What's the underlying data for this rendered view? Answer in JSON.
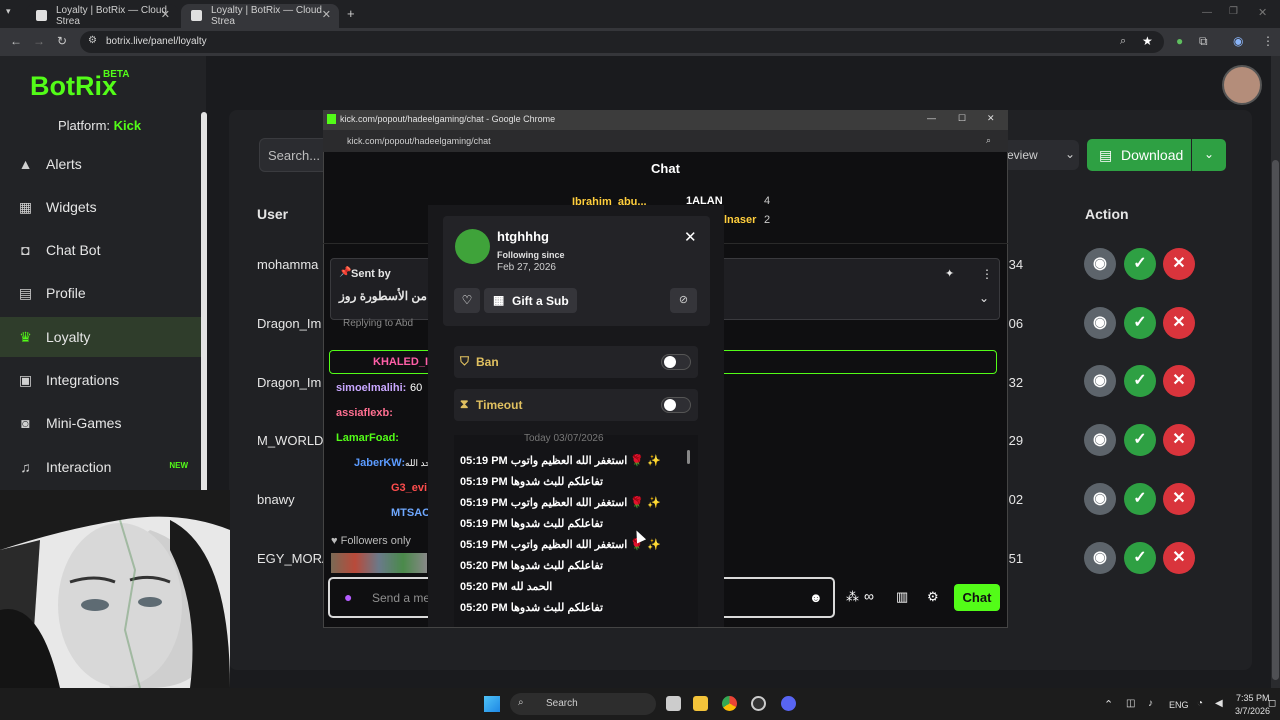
{
  "browser": {
    "tabs": [
      {
        "title": "Loyalty | BotRix — Cloud Strea"
      },
      {
        "title": "Loyalty | BotRix — Cloud Strea"
      }
    ],
    "url": "botrix.live/panel/loyalty"
  },
  "app": {
    "logo": "BotRix",
    "beta": "BETA",
    "platform_label": "Platform:",
    "platform_value": "Kick",
    "nav": [
      {
        "label": "Alerts",
        "icon": "warning-icon"
      },
      {
        "label": "Widgets",
        "icon": "grid-icon"
      },
      {
        "label": "Chat Bot",
        "icon": "robot-icon"
      },
      {
        "label": "Profile",
        "icon": "profile-card-icon"
      },
      {
        "label": "Loyalty",
        "icon": "trophy-icon",
        "active": true
      },
      {
        "label": "Integrations",
        "icon": "puzzle-icon"
      },
      {
        "label": "Mini-Games",
        "icon": "gamepad-icon"
      },
      {
        "label": "Interaction",
        "icon": "music-icon",
        "badge": "NEW"
      }
    ],
    "search_placeholder": "Search...",
    "review_label": "eview",
    "download_label": "Download",
    "table": {
      "headers": {
        "user": "User",
        "action": "Action"
      },
      "rows": [
        {
          "user": "mohamma",
          "time": ":34"
        },
        {
          "user": "Dragon_Im",
          "time": ":06"
        },
        {
          "user": "Dragon_Im",
          "time": ":32"
        },
        {
          "user": "M_WORLD",
          "time": ":29"
        },
        {
          "user": "bnawy",
          "time": ":02"
        },
        {
          "user": "EGY_MORA",
          "time": ":51"
        }
      ]
    }
  },
  "popup": {
    "window_title": "kick.com/popout/hadeelgaming/chat - Google Chrome",
    "url": "kick.com/popout/hadeelgaming/chat",
    "header": "Chat",
    "top_gifters": [
      {
        "name": "Ibrahim_abu...",
        "count": "4"
      },
      {
        "name": "1ALAN",
        "count": ""
      },
      {
        "name": "lnaser",
        "count": "2"
      }
    ],
    "pinned": {
      "sent_by": "Sent by",
      "text": "لار من الأسطورة روز"
    },
    "chat_lines": [
      {
        "user": "KHALED_I",
        "color": "#ff5fa8"
      },
      {
        "user": "simoelmalihi:",
        "text": "60",
        "color": "#c9a7ff"
      },
      {
        "user": "assiaflexb:",
        "color": "#ff6f91"
      },
      {
        "user": "LamarFoad:",
        "color": "#53fc18"
      },
      {
        "user": "JaberKW:",
        "text": "حد الله",
        "color": "#5b9bff"
      },
      {
        "user": "G3_evi",
        "color": "#ff4d4d"
      },
      {
        "user": "MTSAC",
        "color": "#6fa8ff"
      }
    ],
    "replying": "Replying to Abd",
    "followers_only": "Followers only",
    "input_placeholder": "Send a me",
    "chat_button": "Chat"
  },
  "usercard": {
    "username": "htghhhg",
    "following_since_label": "Following since",
    "following_date": "Feb 27, 2026",
    "gift_sub": "Gift a Sub",
    "ban": "Ban",
    "timeout": "Timeout",
    "today": "Today 03/07/2026",
    "messages": [
      {
        "time": "05:19 PM",
        "text": "استغفر الله العظيم واتوب 🌹 ✨"
      },
      {
        "time": "05:19 PM",
        "text": "تفاعلكم للبث شدوها"
      },
      {
        "time": "05:19 PM",
        "text": "استغفر الله العظيم واتوب 🌹 ✨"
      },
      {
        "time": "05:19 PM",
        "text": "تفاعلكم للبث شدوها"
      },
      {
        "time": "05:19 PM",
        "text": "استغفر الله العظيم واتوب 🌹 ✨"
      },
      {
        "time": "05:20 PM",
        "text": "تفاعلكم للبث شدوها"
      },
      {
        "time": "05:20 PM",
        "text": "الحمد لله"
      },
      {
        "time": "05:20 PM",
        "text": "تفاعلكم للبث شدوها"
      }
    ]
  },
  "taskbar": {
    "search": "Search",
    "lang": "ENG",
    "time": "7:35 PM",
    "date": "3/7/2026"
  }
}
